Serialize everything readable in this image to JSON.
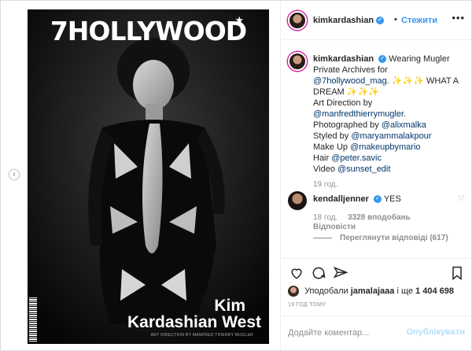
{
  "cover": {
    "title": "7HOLLYWOOD",
    "star": "★",
    "name_line1": "Kim",
    "name_line2": "Kardashian West",
    "credit": "ART DIRECTION BY MANFRED THIERRY MUGLER"
  },
  "header": {
    "username": "kimkardashian",
    "separator": "•",
    "follow_label": "Стежити",
    "more": "•••"
  },
  "caption": {
    "username": "kimkardashian",
    "parts": [
      {
        "text": "Wearing Mugler Private Archives for ",
        "type": "plain"
      },
      {
        "text": "@7hollywood_mag",
        "type": "tag"
      },
      {
        "text": ". ✨✨✨ WHAT A DREAM ✨✨✨",
        "type": "plain"
      },
      {
        "text": "Art Direction by",
        "type": "plain"
      },
      {
        "text": "@manfredthierrymugler",
        "type": "tag"
      },
      {
        "text": "Photographed by ",
        "type": "plain"
      },
      {
        "text": "@alixmalka",
        "type": "tag"
      },
      {
        "text": "Styled by ",
        "type": "plain"
      },
      {
        "text": "@maryammalakpour",
        "type": "tag"
      },
      {
        "text": "Make Up ",
        "type": "plain"
      },
      {
        "text": "@makeupbymario",
        "type": "tag"
      },
      {
        "text": "Hair ",
        "type": "plain"
      },
      {
        "text": "@peter.savic",
        "type": "tag"
      },
      {
        "text": "Video ",
        "type": "plain"
      },
      {
        "text": "@sunset_edit",
        "type": "tag"
      }
    ],
    "time": "19 год."
  },
  "comment": {
    "username": "kendalljenner",
    "text": "YES",
    "time": "18 год.",
    "likes": "3328 вподобань",
    "reply_label": "Відповісти",
    "view_replies": "Переглянути відповіді (617)"
  },
  "actions": {
    "liked_prefix": "Уподобали",
    "liked_user": "jamalajaaa",
    "liked_mid": "і ще",
    "liked_count": "1 404 698",
    "post_time": "19 ГОД ТОМУ",
    "comment_placeholder": "Додайте коментар...",
    "publish_label": "Опублікувати"
  },
  "colors": {
    "link": "#00376b",
    "accent": "#3897f0",
    "muted": "#8e8e8e"
  }
}
